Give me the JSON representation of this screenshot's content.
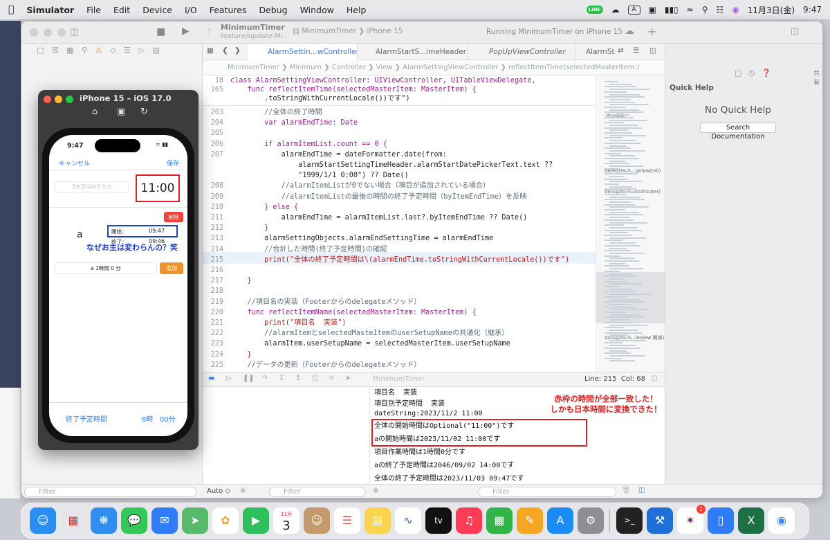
{
  "menubar": {
    "app": "Simulator",
    "items": [
      "File",
      "Edit",
      "Device",
      "I/O",
      "Features",
      "Debug",
      "Window",
      "Help"
    ],
    "datetime": "11月3日(金)",
    "time": "9:47",
    "line_badge": "LINE",
    "input_badge": "A"
  },
  "xcode": {
    "project": "MinimumTimer",
    "branch": "feature/update-Mi...",
    "scheme": "MinimumTimer",
    "device": "iPhone 15",
    "status": "Running MinimumTimer on iPhone 15",
    "tabs": [
      "AlarmSettin...wController",
      "AlarmStartS...imeHeader",
      "PopUpViewController",
      "AlarmSta"
    ],
    "jumpbar": [
      "MinimumTimer",
      "Minimum",
      "Controller",
      "View",
      "AlarmSettingViewController",
      "reflectItemTime(selectedMasterItem:)"
    ],
    "sticky": [
      {
        "n": "18",
        "t": "class AlarmSettingViewController: UIViewController, UITableViewDelegate,"
      },
      {
        "n": "165",
        "t": "    func reflectItemTime(selectedMasterItem: MasterItem) {"
      },
      {
        "n": "",
        "t": "        .toStringWithCurrentLocale())です\")"
      }
    ],
    "code": [
      {
        "n": "203",
        "t": "        //全体の終了時間"
      },
      {
        "n": "204",
        "t": "        var alarmEndTime: Date"
      },
      {
        "n": "205",
        "t": ""
      },
      {
        "n": "206",
        "t": "        if alarmItemList.count == 0 {"
      },
      {
        "n": "207",
        "t": "            alarmEndTime = dateFormatter.date(from:"
      },
      {
        "n": "",
        "t": "                alarmStartSettingTimeHeader.alarmStartDatePickerText.text ??"
      },
      {
        "n": "",
        "t": "                \"1999/1/1 0:00\") ?? Date()"
      },
      {
        "n": "208",
        "t": "            //alarmItemListが0でない場合（項目が追加されている場合）"
      },
      {
        "n": "209",
        "t": "            //alarmItemListの最後の時間の終了予定時間（byItemEndTime）を反映"
      },
      {
        "n": "210",
        "t": "        } else {"
      },
      {
        "n": "211",
        "t": "            alarmEndTime = alarmItemList.last?.byItemEndTime ?? Date()"
      },
      {
        "n": "212",
        "t": "        }"
      },
      {
        "n": "213",
        "t": "        alarmSettingObjects.alarmEndSettingTime = alarmEndTime"
      },
      {
        "n": "214",
        "t": "        //合計した時間(終了予定時間)の確認"
      },
      {
        "n": "215",
        "t": "        print(\"全体の終了予定時間は\\(alarmEndTime.toStringWithCurrentLocale())です\")"
      },
      {
        "n": "216",
        "t": ""
      },
      {
        "n": "217",
        "t": "    }"
      },
      {
        "n": "218",
        "t": ""
      },
      {
        "n": "219",
        "t": "    //項目名の実装（Footerからのdelegateメソッド）"
      },
      {
        "n": "220",
        "t": "    func reflectItemName(selectedMasterItem: MasterItem) {"
      },
      {
        "n": "221",
        "t": "        print(\"項目名  実装\")"
      },
      {
        "n": "222",
        "t": "        //alarmItemとselectedMasteItemのuserSetupNameの共通化（継承）"
      },
      {
        "n": "223",
        "t": "        alarmItem.userSetupName = selectedMasterItem.userSetupName"
      },
      {
        "n": "224",
        "t": "    }"
      },
      {
        "n": "225",
        "t": "    //データの更新（Footerからのdelegateメソッド）"
      }
    ],
    "minimap_labels": [
      "追加関数",
      "delegate X...gViewCell)",
      "delegate X...tedFooter)",
      "delegate X...leView 関係)"
    ],
    "cursor": "Line: 215  Col: 68",
    "console": [
      "項目名  実装",
      "項目別予定時間  実装",
      "dateString:2023/11/2 11:00",
      "全体の開始時間はOptional(\"11:00\")です",
      "aの開始時間は2023/11/02 11:00です",
      "項目作業時間は1時間0分です",
      "aの終了予定時間は2046/09/02 14:00です",
      "全体の終了予定時間は2023/11/03 09:47です"
    ],
    "annotation_console": [
      "赤枠の時間が全部一致した！",
      "しかも日本時間に変換できた！"
    ],
    "quick_help": {
      "title": "Quick Help",
      "empty": "No Quick Help",
      "button": "Search Documentation"
    },
    "filter_placeholder": "Filter",
    "auto_label": "Auto ◇",
    "side_label": "共有"
  },
  "simulator": {
    "title": "iPhone 15 – iOS 17.0",
    "status_time": "9:47",
    "cancel": "キャンセル",
    "save": "保存",
    "name_placeholder": "5文字以内で入力",
    "start_time": "11:00",
    "delete": "削除",
    "item_name": "a",
    "start_label": "開始：",
    "start_value": "09:47",
    "end_label": "終了：",
    "end_value": "09:46",
    "annotation": "なぜお主は変わらんの？笑",
    "add_item": "a  1時間 0 分",
    "add": "追加",
    "footer_label": "終了予定時間",
    "footer_hours": "8時",
    "footer_minutes": "00分"
  },
  "dock": {
    "calendar_month": "11月",
    "calendar_day": "3",
    "appletv": "tv",
    "reminder_badge": "1"
  },
  "colors": {
    "accent": "#2f7cf6",
    "annotation_red": "#e02020",
    "annotation_blue": "#1f3fd0",
    "delete_red": "#f2433a",
    "add_orange": "#f0932b"
  }
}
